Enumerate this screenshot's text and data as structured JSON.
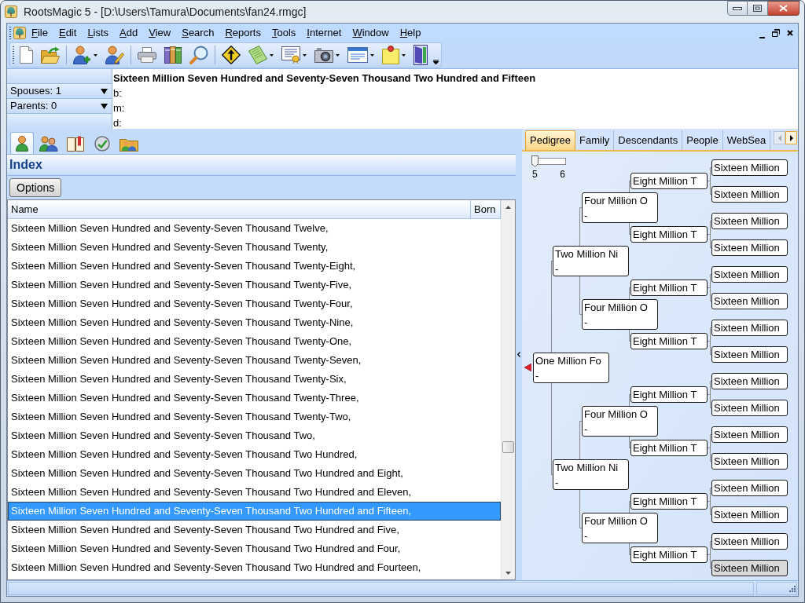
{
  "window": {
    "title": "RootsMagic 5 - [D:\\Users\\Tamura\\Documents\\fan24.rmgc]"
  },
  "menu": [
    {
      "label": "File"
    },
    {
      "label": "Edit"
    },
    {
      "label": "Lists"
    },
    {
      "label": "Add"
    },
    {
      "label": "View"
    },
    {
      "label": "Search"
    },
    {
      "label": "Reports"
    },
    {
      "label": "Tools"
    },
    {
      "label": "Internet"
    },
    {
      "label": "Window"
    },
    {
      "label": "Help"
    }
  ],
  "toolbar": [
    {
      "kind": "new-file",
      "dropdown": false
    },
    {
      "kind": "open-folder",
      "dropdown": false
    },
    {
      "kind": "separator"
    },
    {
      "kind": "add-person",
      "dropdown": true
    },
    {
      "kind": "edit-person",
      "dropdown": false
    },
    {
      "kind": "separator"
    },
    {
      "kind": "printer",
      "dropdown": false
    },
    {
      "kind": "books",
      "dropdown": false
    },
    {
      "kind": "magnifier",
      "dropdown": false
    },
    {
      "kind": "separator"
    },
    {
      "kind": "road-sign",
      "dropdown": false
    },
    {
      "kind": "notebook",
      "dropdown": true
    },
    {
      "kind": "certificate",
      "dropdown": true
    },
    {
      "kind": "camera",
      "dropdown": true
    },
    {
      "kind": "form",
      "dropdown": true
    },
    {
      "kind": "sticky-note",
      "dropdown": true
    },
    {
      "kind": "door",
      "dropdown": false
    }
  ],
  "person_header": {
    "spouses": "Spouses: 1",
    "parents": "Parents: 0",
    "name": "Sixteen Million Seven Hundred and Seventy-Seven Thousand Two Hundred and Fifteen",
    "birth": "b:",
    "marriage": "m:",
    "death": "d:"
  },
  "left_tabs": [
    {
      "kind": "person",
      "selected": true
    },
    {
      "kind": "family",
      "selected": false
    },
    {
      "kind": "book",
      "selected": false
    },
    {
      "kind": "web",
      "selected": false
    },
    {
      "kind": "group",
      "selected": false
    }
  ],
  "index_panel": {
    "title": "Index",
    "options_button": "Options",
    "columns": [
      "Name",
      "Born"
    ],
    "rows": [
      {
        "name": "Sixteen Million Seven Hundred and Seventy-Seven Thousand Twelve,",
        "selected": false
      },
      {
        "name": "Sixteen Million Seven Hundred and Seventy-Seven Thousand Twenty,",
        "selected": false
      },
      {
        "name": "Sixteen Million Seven Hundred and Seventy-Seven Thousand Twenty-Eight,",
        "selected": false
      },
      {
        "name": "Sixteen Million Seven Hundred and Seventy-Seven Thousand Twenty-Five,",
        "selected": false
      },
      {
        "name": "Sixteen Million Seven Hundred and Seventy-Seven Thousand Twenty-Four,",
        "selected": false
      },
      {
        "name": "Sixteen Million Seven Hundred and Seventy-Seven Thousand Twenty-Nine,",
        "selected": false
      },
      {
        "name": "Sixteen Million Seven Hundred and Seventy-Seven Thousand Twenty-One,",
        "selected": false
      },
      {
        "name": "Sixteen Million Seven Hundred and Seventy-Seven Thousand Twenty-Seven,",
        "selected": false
      },
      {
        "name": "Sixteen Million Seven Hundred and Seventy-Seven Thousand Twenty-Six,",
        "selected": false
      },
      {
        "name": "Sixteen Million Seven Hundred and Seventy-Seven Thousand Twenty-Three,",
        "selected": false
      },
      {
        "name": "Sixteen Million Seven Hundred and Seventy-Seven Thousand Twenty-Two,",
        "selected": false
      },
      {
        "name": "Sixteen Million Seven Hundred and Seventy-Seven Thousand Two,",
        "selected": false
      },
      {
        "name": "Sixteen Million Seven Hundred and Seventy-Seven Thousand Two Hundred,",
        "selected": false
      },
      {
        "name": "Sixteen Million Seven Hundred and Seventy-Seven Thousand Two Hundred and Eight,",
        "selected": false
      },
      {
        "name": "Sixteen Million Seven Hundred and Seventy-Seven Thousand Two Hundred and Eleven,",
        "selected": false
      },
      {
        "name": "Sixteen Million Seven Hundred and Seventy-Seven Thousand Two Hundred and Fifteen,",
        "selected": true
      },
      {
        "name": "Sixteen Million Seven Hundred and Seventy-Seven Thousand Two Hundred and Five,",
        "selected": false
      },
      {
        "name": "Sixteen Million Seven Hundred and Seventy-Seven Thousand Two Hundred and Four,",
        "selected": false
      },
      {
        "name": "Sixteen Million Seven Hundred and Seventy-Seven Thousand Two Hundred and Fourteen,",
        "selected": false
      }
    ]
  },
  "right_tabs": [
    {
      "label": "Pedigree",
      "selected": true
    },
    {
      "label": "Family",
      "selected": false
    },
    {
      "label": "Descendants",
      "selected": false
    },
    {
      "label": "People",
      "selected": false
    },
    {
      "label": "WebSea",
      "selected": false
    }
  ],
  "tab_scroll_buttons": [
    {
      "kind": "left",
      "disabled": true
    },
    {
      "kind": "right",
      "disabled": false
    }
  ],
  "pedigree": {
    "slider": {
      "level": 0,
      "min_label": "5",
      "max_label": "6"
    },
    "root": {
      "name": "One Million Fo",
      "dates": "-",
      "highlighted": false,
      "children": [
        {
          "name": "Two Million Ni",
          "dates": "-",
          "highlighted": false,
          "children": [
            {
              "name": "Four Million O",
              "dates": "-",
              "highlighted": false,
              "children": [
                {
                  "name": "Eight Million T",
                  "highlighted": false,
                  "children": [
                    {
                      "name": "Sixteen Million",
                      "highlighted": false
                    },
                    {
                      "name": "Sixteen Million",
                      "highlighted": false
                    }
                  ]
                },
                {
                  "name": "Eight Million T",
                  "highlighted": false,
                  "children": [
                    {
                      "name": "Sixteen Million",
                      "highlighted": false
                    },
                    {
                      "name": "Sixteen Million",
                      "highlighted": false
                    }
                  ]
                }
              ]
            },
            {
              "name": "Four Million O",
              "dates": "-",
              "highlighted": false,
              "children": [
                {
                  "name": "Eight Million T",
                  "highlighted": false,
                  "children": [
                    {
                      "name": "Sixteen Million",
                      "highlighted": false
                    },
                    {
                      "name": "Sixteen Million",
                      "highlighted": false
                    }
                  ]
                },
                {
                  "name": "Eight Million T",
                  "highlighted": false,
                  "children": [
                    {
                      "name": "Sixteen Million",
                      "highlighted": false
                    },
                    {
                      "name": "Sixteen Million",
                      "highlighted": false
                    }
                  ]
                }
              ]
            }
          ]
        },
        {
          "name": "Two Million Ni",
          "dates": "-",
          "highlighted": false,
          "children": [
            {
              "name": "Four Million O",
              "dates": "-",
              "highlighted": false,
              "children": [
                {
                  "name": "Eight Million T",
                  "highlighted": false,
                  "children": [
                    {
                      "name": "Sixteen Million",
                      "highlighted": false
                    },
                    {
                      "name": "Sixteen Million",
                      "highlighted": false
                    }
                  ]
                },
                {
                  "name": "Eight Million T",
                  "highlighted": false,
                  "children": [
                    {
                      "name": "Sixteen Million",
                      "highlighted": false
                    },
                    {
                      "name": "Sixteen Million",
                      "highlighted": false
                    }
                  ]
                }
              ]
            },
            {
              "name": "Four Million O",
              "dates": "-",
              "highlighted": false,
              "children": [
                {
                  "name": "Eight Million T",
                  "highlighted": false,
                  "children": [
                    {
                      "name": "Sixteen Million",
                      "highlighted": false
                    },
                    {
                      "name": "Sixteen Million",
                      "highlighted": false
                    }
                  ]
                },
                {
                  "name": "Eight Million T",
                  "highlighted": false,
                  "children": [
                    {
                      "name": "Sixteen Million",
                      "highlighted": false
                    },
                    {
                      "name": "Sixteen Million",
                      "highlighted": true
                    }
                  ]
                }
              ]
            }
          ]
        }
      ]
    }
  }
}
